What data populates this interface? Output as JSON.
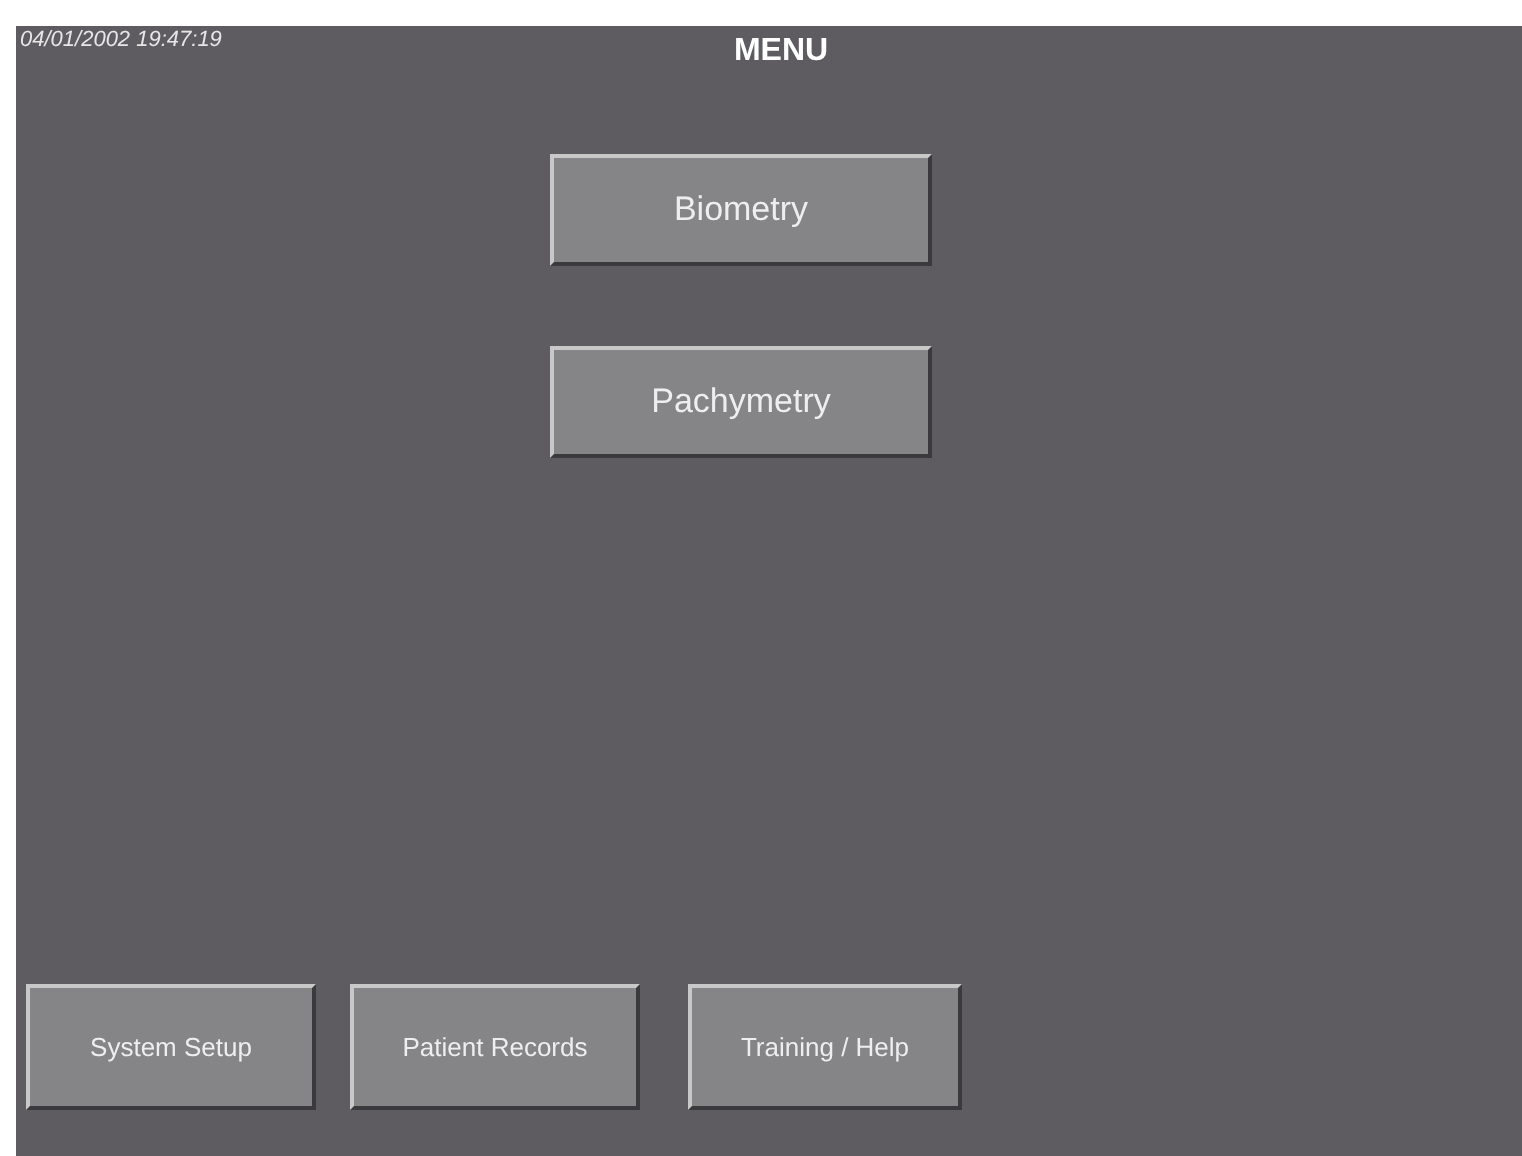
{
  "timestamp": "04/01/2002 19:47:19",
  "title": "MENU",
  "menu_buttons": [
    "Biometry",
    "Pachymetry"
  ],
  "bottom_buttons": [
    "System Setup",
    "Patient Records",
    "Training / Help"
  ]
}
